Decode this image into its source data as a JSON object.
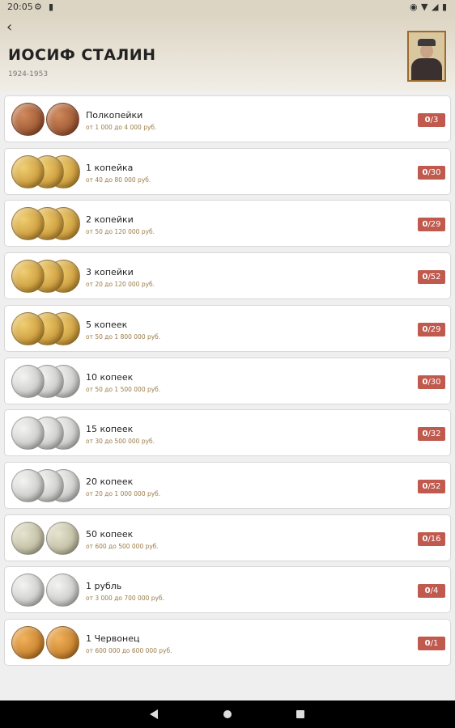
{
  "status_bar": {
    "time": "20:05",
    "left_icons": [
      "gear-icon",
      "sd-card-icon"
    ],
    "right_icons": [
      "location-icon",
      "wifi-icon",
      "signal-icon",
      "battery-icon"
    ]
  },
  "header": {
    "title": "ИОСИФ СТАЛИН",
    "years": "1924-1953"
  },
  "colors": {
    "header_gradient_top": "#ddd5c3",
    "header_gradient_bottom": "#f1eee7",
    "badge": "#c05a4e",
    "price_text": "#9b7b47",
    "copper": "#a9623b",
    "brass": "#cf9f3d",
    "silver": "#c9c9c7",
    "gold": "#c8822d",
    "background": "#efefef"
  },
  "items": [
    {
      "name": "Полкопейки",
      "price": "от 1 000 до 4 000 руб.",
      "owned": "0",
      "total": "/3",
      "metal": "copper",
      "coin_count": 2
    },
    {
      "name": "1 копейка",
      "price": "от 40 до 80 000 руб.",
      "owned": "0",
      "total": "/30",
      "metal": "brass",
      "coin_count": 3
    },
    {
      "name": "2 копейки",
      "price": "от 50 до 120 000 руб.",
      "owned": "0",
      "total": "/29",
      "metal": "brass",
      "coin_count": 3
    },
    {
      "name": "3 копейки",
      "price": "от 20 до 120 000 руб.",
      "owned": "0",
      "total": "/52",
      "metal": "brass",
      "coin_count": 3
    },
    {
      "name": "5 копеек",
      "price": "от 50 до 1 800 000 руб.",
      "owned": "0",
      "total": "/29",
      "metal": "brass",
      "coin_count": 3
    },
    {
      "name": "10 копеек",
      "price": "от 50 до 1 500 000 руб.",
      "owned": "0",
      "total": "/30",
      "metal": "silver",
      "coin_count": 3
    },
    {
      "name": "15 копеек",
      "price": "от 30 до 500 000 руб.",
      "owned": "0",
      "total": "/32",
      "metal": "silver",
      "coin_count": 3
    },
    {
      "name": "20 копеек",
      "price": "от 20 до 1 000 000 руб.",
      "owned": "0",
      "total": "/52",
      "metal": "silver",
      "coin_count": 3
    },
    {
      "name": "50 копеек",
      "price": "от 600 до 500 000 руб.",
      "owned": "0",
      "total": "/16",
      "metal": "silver_old",
      "coin_count": 2
    },
    {
      "name": "1 рубль",
      "price": "от 3 000 до 700 000 руб.",
      "owned": "0",
      "total": "/4",
      "metal": "silver",
      "coin_count": 2
    },
    {
      "name": "1 Червонец",
      "price": "от 600 000 до 600 000 руб.",
      "owned": "0",
      "total": "/1",
      "metal": "gold",
      "coin_count": 2
    }
  ],
  "nav_bar": {
    "icons": [
      "nav-back-icon",
      "nav-home-icon",
      "nav-recents-icon"
    ]
  }
}
